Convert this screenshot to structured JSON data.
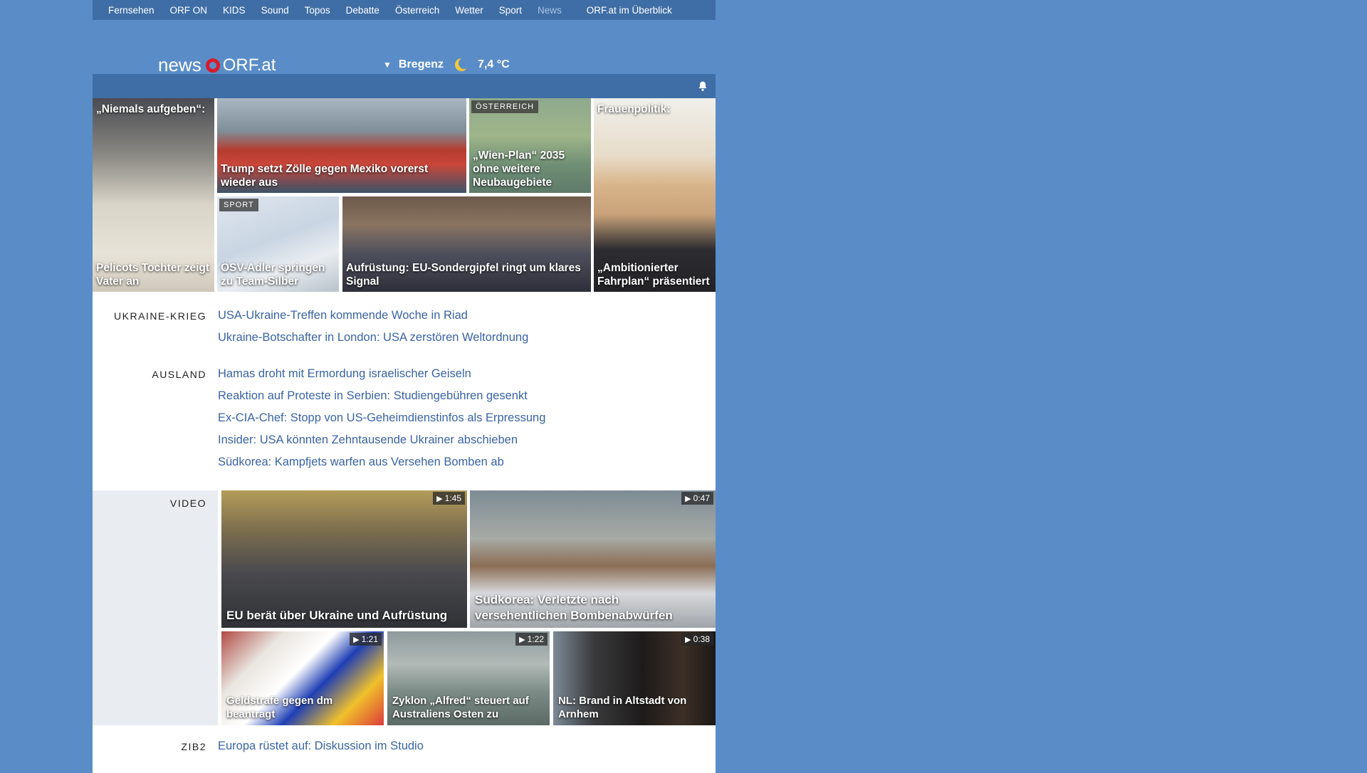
{
  "nav": {
    "items": [
      "Fernsehen",
      "ORF ON",
      "KIDS",
      "Sound",
      "Topos",
      "Debatte",
      "Österreich",
      "Wetter",
      "Sport",
      "News"
    ],
    "overview": "ORF.at im Überblick"
  },
  "header": {
    "logo_news": "news",
    "logo_orf": "ORF.at",
    "location": "Bregenz",
    "temperature": "7,4 °C"
  },
  "teasers": {
    "t1": "„Niemals aufgeben“:",
    "t1b": "Pelicots Tochter zeigt Vater an",
    "t2": "Trump setzt Zölle gegen Mexiko vorerst wieder aus",
    "t3_label": "ÖSTERREICH",
    "t3": "„Wien-Plan“ 2035 ohne weitere Neubaugebiete",
    "t4": "Frauenpolitik:",
    "t4b": "„Ambitionierter Fahrplan“ präsentiert",
    "t5_label": "SPORT",
    "t5": "ÖSV-Adler springen zu Team-Silber",
    "t6": "Aufrüstung: EU-Sondergipfel ringt um klares Signal"
  },
  "sections": {
    "ukraine": {
      "label": "UKRAINE-KRIEG",
      "links": [
        "USA-Ukraine-Treffen kommende Woche in Riad",
        "Ukraine-Botschafter in London: USA zerstören Weltordnung"
      ]
    },
    "ausland": {
      "label": "AUSLAND",
      "links": [
        "Hamas droht mit Ermordung israelischer Geiseln",
        "Reaktion auf Proteste in Serbien: Studiengebühren gesenkt",
        "Ex-CIA-Chef: Stopp von US-Geheimdienstinfos als Erpressung",
        "Insider: USA könnten Zehntausende Ukrainer abschieben",
        "Südkorea: Kampfjets warfen aus Versehen Bomben ab"
      ]
    },
    "video": {
      "label": "VIDEO",
      "items": [
        {
          "title": "EU berät über Ukraine und Aufrüstung",
          "duration": "1:45"
        },
        {
          "title": "Südkorea: Verletzte nach versehentlichen Bombenabwürfen",
          "duration": "0:47"
        },
        {
          "title": "Geldstrafe gegen dm beantragt",
          "duration": "1:21"
        },
        {
          "title": "Zyklon „Alfred“ steuert auf Australiens Osten zu",
          "duration": "1:22"
        },
        {
          "title": "NL: Brand in Altstadt von Arnhem",
          "duration": "0:38"
        }
      ]
    },
    "zib2": {
      "label": "ZIB2",
      "links": [
        "Europa rüstet auf: Diskussion im Studio"
      ]
    }
  },
  "colors": {
    "page_bg": "#5a8dc8",
    "nav_bg": "#3f6ea6",
    "link": "#3a64a5",
    "brand_red": "#d81c2a"
  }
}
